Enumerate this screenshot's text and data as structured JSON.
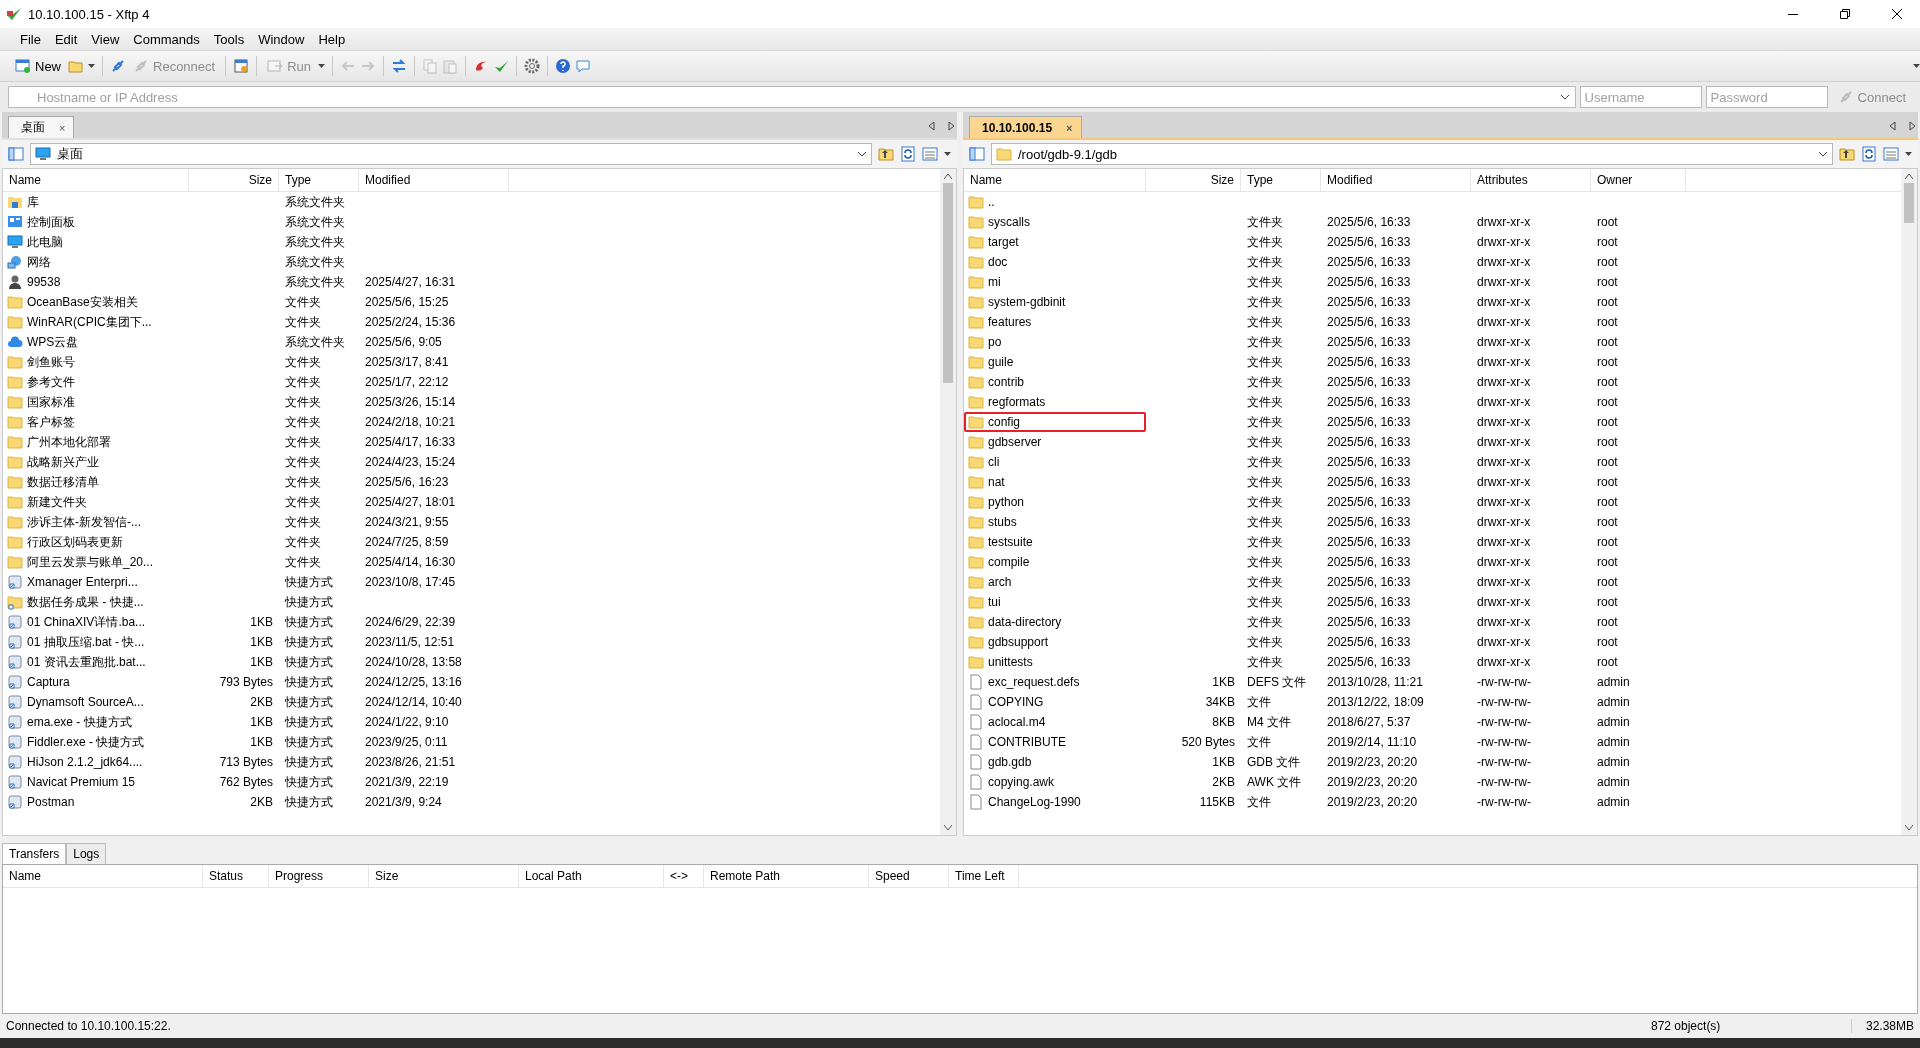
{
  "window": {
    "title": "10.10.100.15 - Xftp 4"
  },
  "menu": [
    "File",
    "Edit",
    "View",
    "Commands",
    "Tools",
    "Window",
    "Help"
  ],
  "toolbar": [
    {
      "label": "New",
      "disabled": false
    },
    {
      "label": "Reconnect",
      "disabled": true
    },
    {
      "label": "Run",
      "disabled": true
    }
  ],
  "address_bar": {
    "host_placeholder": "Hostname or IP Address",
    "username_placeholder": "Username",
    "password_placeholder": "Password",
    "connect": {
      "label": "Connect",
      "disabled": true
    }
  },
  "panes": [
    {
      "tab": {
        "label": "桌面",
        "selected": false,
        "close": "×"
      },
      "path": {
        "kind": "computer",
        "text": "桌面"
      },
      "columns": [
        "Name",
        "Size",
        "Type",
        "Modified"
      ],
      "rows": [
        {
          "kind": "library",
          "name": "库",
          "size": "",
          "type": "系统文件夹",
          "modified": ""
        },
        {
          "kind": "control-panel",
          "name": "控制面板",
          "size": "",
          "type": "系统文件夹",
          "modified": ""
        },
        {
          "kind": "computer",
          "name": "此电脑",
          "size": "",
          "type": "系统文件夹",
          "modified": ""
        },
        {
          "kind": "network",
          "name": "网络",
          "size": "",
          "type": "系统文件夹",
          "modified": ""
        },
        {
          "kind": "user",
          "name": "99538",
          "size": "",
          "type": "系统文件夹",
          "modified": "2025/4/27, 16:31"
        },
        {
          "kind": "folder",
          "name": "OceanBase安装相关",
          "size": "",
          "type": "文件夹",
          "modified": "2025/5/6, 15:25"
        },
        {
          "kind": "folder",
          "name": "WinRAR(CPIC集团下...",
          "size": "",
          "type": "文件夹",
          "modified": "2025/2/24, 15:36"
        },
        {
          "kind": "cloud",
          "name": "WPS云盘",
          "size": "",
          "type": "系统文件夹",
          "modified": "2025/5/6, 9:05"
        },
        {
          "kind": "folder",
          "name": "剑鱼账号",
          "size": "",
          "type": "文件夹",
          "modified": "2025/3/17, 8:41"
        },
        {
          "kind": "folder",
          "name": "参考文件",
          "size": "",
          "type": "文件夹",
          "modified": "2025/1/7, 22:12"
        },
        {
          "kind": "folder",
          "name": "国家标准",
          "size": "",
          "type": "文件夹",
          "modified": "2025/3/26, 15:14"
        },
        {
          "kind": "folder",
          "name": "客户标签",
          "size": "",
          "type": "文件夹",
          "modified": "2024/2/18, 10:21"
        },
        {
          "kind": "folder",
          "name": "广州本地化部署",
          "size": "",
          "type": "文件夹",
          "modified": "2025/4/17, 16:33"
        },
        {
          "kind": "folder",
          "name": "战略新兴产业",
          "size": "",
          "type": "文件夹",
          "modified": "2024/4/23, 15:24"
        },
        {
          "kind": "folder",
          "name": "数据迁移清单",
          "size": "",
          "type": "文件夹",
          "modified": "2025/5/6, 16:23"
        },
        {
          "kind": "folder",
          "name": "新建文件夹",
          "size": "",
          "type": "文件夹",
          "modified": "2025/4/27, 18:01"
        },
        {
          "kind": "folder",
          "name": "涉诉主体-新发智信-...",
          "size": "",
          "type": "文件夹",
          "modified": "2024/3/21, 9:55"
        },
        {
          "kind": "folder",
          "name": "行政区划码表更新",
          "size": "",
          "type": "文件夹",
          "modified": "2024/7/25, 8:59"
        },
        {
          "kind": "folder",
          "name": "阿里云发票与账单_20...",
          "size": "",
          "type": "文件夹",
          "modified": "2025/4/14, 16:30"
        },
        {
          "kind": "shortcut",
          "name": "Xmanager Enterpri...",
          "size": "",
          "type": "快捷方式",
          "modified": "2023/10/8, 17:45"
        },
        {
          "kind": "shortcut-folder",
          "name": "数据任务成果 - 快捷...",
          "size": "",
          "type": "快捷方式",
          "modified": ""
        },
        {
          "kind": "shortcut",
          "name": "01 ChinaXIV详情.ba...",
          "size": "1KB",
          "type": "快捷方式",
          "modified": "2024/6/29, 22:39"
        },
        {
          "kind": "shortcut",
          "name": "01 抽取压缩.bat - 快...",
          "size": "1KB",
          "type": "快捷方式",
          "modified": "2023/11/5, 12:51"
        },
        {
          "kind": "shortcut",
          "name": "01 资讯去重跑批.bat...",
          "size": "1KB",
          "type": "快捷方式",
          "modified": "2024/10/28, 13:58"
        },
        {
          "kind": "shortcut",
          "name": "Captura",
          "size": "793 Bytes",
          "type": "快捷方式",
          "modified": "2024/12/25, 13:16"
        },
        {
          "kind": "shortcut",
          "name": "Dynamsoft SourceA...",
          "size": "2KB",
          "type": "快捷方式",
          "modified": "2024/12/14, 10:40"
        },
        {
          "kind": "shortcut",
          "name": "ema.exe - 快捷方式",
          "size": "1KB",
          "type": "快捷方式",
          "modified": "2024/1/22, 9:10"
        },
        {
          "kind": "shortcut",
          "name": "Fiddler.exe - 快捷方式",
          "size": "1KB",
          "type": "快捷方式",
          "modified": "2023/9/25, 0:11"
        },
        {
          "kind": "shortcut",
          "name": "HiJson 2.1.2_jdk64....",
          "size": "713 Bytes",
          "type": "快捷方式",
          "modified": "2023/8/26, 21:51"
        },
        {
          "kind": "shortcut",
          "name": "Navicat Premium 15",
          "size": "762 Bytes",
          "type": "快捷方式",
          "modified": "2021/3/9, 22:19"
        },
        {
          "kind": "shortcut",
          "name": "Postman",
          "size": "2KB",
          "type": "快捷方式",
          "modified": "2021/3/9, 9:24"
        }
      ]
    },
    {
      "tab": {
        "label": "10.10.100.15",
        "selected": true,
        "close": "×"
      },
      "path": {
        "kind": "folder",
        "text": "/root/gdb-9.1/gdb"
      },
      "columns": [
        "Name",
        "Size",
        "Type",
        "Modified",
        "Attributes",
        "Owner"
      ],
      "rows": [
        {
          "kind": "folder",
          "name": "..",
          "size": "",
          "type": "",
          "modified": "",
          "attributes": "",
          "owner": "",
          "highlighted": false
        },
        {
          "kind": "folder",
          "name": "syscalls",
          "size": "",
          "type": "文件夹",
          "modified": "2025/5/6, 16:33",
          "attributes": "drwxr-xr-x",
          "owner": "root",
          "highlighted": false
        },
        {
          "kind": "folder",
          "name": "target",
          "size": "",
          "type": "文件夹",
          "modified": "2025/5/6, 16:33",
          "attributes": "drwxr-xr-x",
          "owner": "root",
          "highlighted": false
        },
        {
          "kind": "folder",
          "name": "doc",
          "size": "",
          "type": "文件夹",
          "modified": "2025/5/6, 16:33",
          "attributes": "drwxr-xr-x",
          "owner": "root",
          "highlighted": false
        },
        {
          "kind": "folder",
          "name": "mi",
          "size": "",
          "type": "文件夹",
          "modified": "2025/5/6, 16:33",
          "attributes": "drwxr-xr-x",
          "owner": "root",
          "highlighted": false
        },
        {
          "kind": "folder",
          "name": "system-gdbinit",
          "size": "",
          "type": "文件夹",
          "modified": "2025/5/6, 16:33",
          "attributes": "drwxr-xr-x",
          "owner": "root",
          "highlighted": false
        },
        {
          "kind": "folder",
          "name": "features",
          "size": "",
          "type": "文件夹",
          "modified": "2025/5/6, 16:33",
          "attributes": "drwxr-xr-x",
          "owner": "root",
          "highlighted": false
        },
        {
          "kind": "folder",
          "name": "po",
          "size": "",
          "type": "文件夹",
          "modified": "2025/5/6, 16:33",
          "attributes": "drwxr-xr-x",
          "owner": "root",
          "highlighted": false
        },
        {
          "kind": "folder",
          "name": "guile",
          "size": "",
          "type": "文件夹",
          "modified": "2025/5/6, 16:33",
          "attributes": "drwxr-xr-x",
          "owner": "root",
          "highlighted": false
        },
        {
          "kind": "folder",
          "name": "contrib",
          "size": "",
          "type": "文件夹",
          "modified": "2025/5/6, 16:33",
          "attributes": "drwxr-xr-x",
          "owner": "root",
          "highlighted": false
        },
        {
          "kind": "folder",
          "name": "regformats",
          "size": "",
          "type": "文件夹",
          "modified": "2025/5/6, 16:33",
          "attributes": "drwxr-xr-x",
          "owner": "root",
          "highlighted": false
        },
        {
          "kind": "folder",
          "name": "config",
          "size": "",
          "type": "文件夹",
          "modified": "2025/5/6, 16:33",
          "attributes": "drwxr-xr-x",
          "owner": "root",
          "highlighted": true
        },
        {
          "kind": "folder",
          "name": "gdbserver",
          "size": "",
          "type": "文件夹",
          "modified": "2025/5/6, 16:33",
          "attributes": "drwxr-xr-x",
          "owner": "root",
          "highlighted": false
        },
        {
          "kind": "folder",
          "name": "cli",
          "size": "",
          "type": "文件夹",
          "modified": "2025/5/6, 16:33",
          "attributes": "drwxr-xr-x",
          "owner": "root",
          "highlighted": false
        },
        {
          "kind": "folder",
          "name": "nat",
          "size": "",
          "type": "文件夹",
          "modified": "2025/5/6, 16:33",
          "attributes": "drwxr-xr-x",
          "owner": "root",
          "highlighted": false
        },
        {
          "kind": "folder",
          "name": "python",
          "size": "",
          "type": "文件夹",
          "modified": "2025/5/6, 16:33",
          "attributes": "drwxr-xr-x",
          "owner": "root",
          "highlighted": false
        },
        {
          "kind": "folder",
          "name": "stubs",
          "size": "",
          "type": "文件夹",
          "modified": "2025/5/6, 16:33",
          "attributes": "drwxr-xr-x",
          "owner": "root",
          "highlighted": false
        },
        {
          "kind": "folder",
          "name": "testsuite",
          "size": "",
          "type": "文件夹",
          "modified": "2025/5/6, 16:33",
          "attributes": "drwxr-xr-x",
          "owner": "root",
          "highlighted": false
        },
        {
          "kind": "folder",
          "name": "compile",
          "size": "",
          "type": "文件夹",
          "modified": "2025/5/6, 16:33",
          "attributes": "drwxr-xr-x",
          "owner": "root",
          "highlighted": false
        },
        {
          "kind": "folder",
          "name": "arch",
          "size": "",
          "type": "文件夹",
          "modified": "2025/5/6, 16:33",
          "attributes": "drwxr-xr-x",
          "owner": "root",
          "highlighted": false
        },
        {
          "kind": "folder",
          "name": "tui",
          "size": "",
          "type": "文件夹",
          "modified": "2025/5/6, 16:33",
          "attributes": "drwxr-xr-x",
          "owner": "root",
          "highlighted": false
        },
        {
          "kind": "folder",
          "name": "data-directory",
          "size": "",
          "type": "文件夹",
          "modified": "2025/5/6, 16:33",
          "attributes": "drwxr-xr-x",
          "owner": "root",
          "highlighted": false
        },
        {
          "kind": "folder",
          "name": "gdbsupport",
          "size": "",
          "type": "文件夹",
          "modified": "2025/5/6, 16:33",
          "attributes": "drwxr-xr-x",
          "owner": "root",
          "highlighted": false
        },
        {
          "kind": "folder",
          "name": "unittests",
          "size": "",
          "type": "文件夹",
          "modified": "2025/5/6, 16:33",
          "attributes": "drwxr-xr-x",
          "owner": "root",
          "highlighted": false
        },
        {
          "kind": "file",
          "name": "exc_request.defs",
          "size": "1KB",
          "type": "DEFS 文件",
          "modified": "2013/10/28, 11:21",
          "attributes": "-rw-rw-rw-",
          "owner": "admin",
          "highlighted": false
        },
        {
          "kind": "file",
          "name": "COPYING",
          "size": "34KB",
          "type": "文件",
          "modified": "2013/12/22, 18:09",
          "attributes": "-rw-rw-rw-",
          "owner": "admin",
          "highlighted": false
        },
        {
          "kind": "file",
          "name": "aclocal.m4",
          "size": "8KB",
          "type": "M4 文件",
          "modified": "2018/6/27, 5:37",
          "attributes": "-rw-rw-rw-",
          "owner": "admin",
          "highlighted": false
        },
        {
          "kind": "file",
          "name": "CONTRIBUTE",
          "size": "520 Bytes",
          "type": "文件",
          "modified": "2019/2/14, 11:10",
          "attributes": "-rw-rw-rw-",
          "owner": "admin",
          "highlighted": false
        },
        {
          "kind": "file",
          "name": "gdb.gdb",
          "size": "1KB",
          "type": "GDB 文件",
          "modified": "2019/2/23, 20:20",
          "attributes": "-rw-rw-rw-",
          "owner": "admin",
          "highlighted": false
        },
        {
          "kind": "file",
          "name": "copying.awk",
          "size": "2KB",
          "type": "AWK 文件",
          "modified": "2019/2/23, 20:20",
          "attributes": "-rw-rw-rw-",
          "owner": "admin",
          "highlighted": false
        },
        {
          "kind": "file",
          "name": "ChangeLog-1990",
          "size": "115KB",
          "type": "文件",
          "modified": "2019/2/23, 20:20",
          "attributes": "-rw-rw-rw-",
          "owner": "admin",
          "highlighted": false
        }
      ]
    }
  ],
  "transfer_tabs": [
    {
      "label": "Transfers",
      "selected": true
    },
    {
      "label": "Logs",
      "selected": false
    }
  ],
  "transfer_columns": [
    "Name",
    "Status",
    "Progress",
    "Size",
    "Local Path",
    "<->",
    "Remote Path",
    "Speed",
    "Time Left"
  ],
  "status_bar": {
    "message": "Connected to 10.10.100.15:22.",
    "objects": "872 object(s)",
    "size": "32.38MB"
  }
}
